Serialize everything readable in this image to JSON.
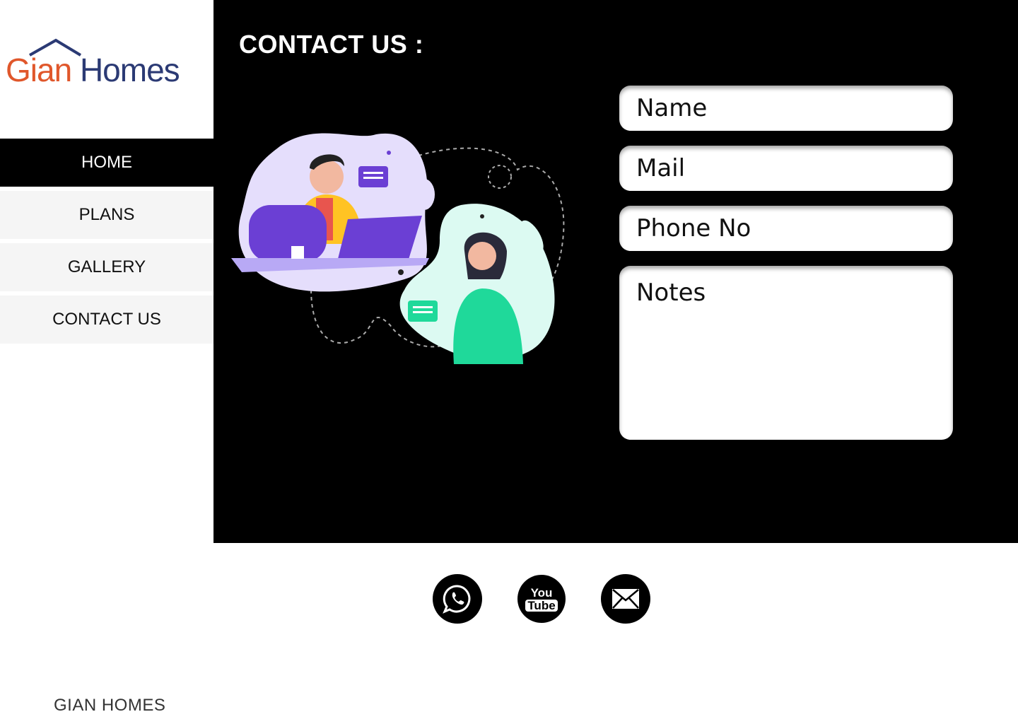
{
  "brand": {
    "logo_word1": "Gian",
    "logo_word2": "Homes",
    "footer": "GIAN HOMES"
  },
  "nav": {
    "items": [
      {
        "label": "HOME",
        "active": true
      },
      {
        "label": "PLANS",
        "active": false
      },
      {
        "label": "GALLERY",
        "active": false
      },
      {
        "label": "CONTACT US",
        "active": false
      }
    ]
  },
  "main": {
    "title": "CONTACT US :"
  },
  "form": {
    "name_placeholder": "Name",
    "mail_placeholder": "Mail",
    "phone_placeholder": "Phone No",
    "notes_placeholder": "Notes"
  },
  "social": [
    {
      "icon": "whatsapp-icon"
    },
    {
      "icon": "youtube-icon",
      "text_top": "You",
      "text_bottom": "Tube"
    },
    {
      "icon": "mail-icon"
    }
  ],
  "colors": {
    "accent_orange": "#e0572b",
    "accent_navy": "#2b3a74",
    "panel": "#000000"
  }
}
